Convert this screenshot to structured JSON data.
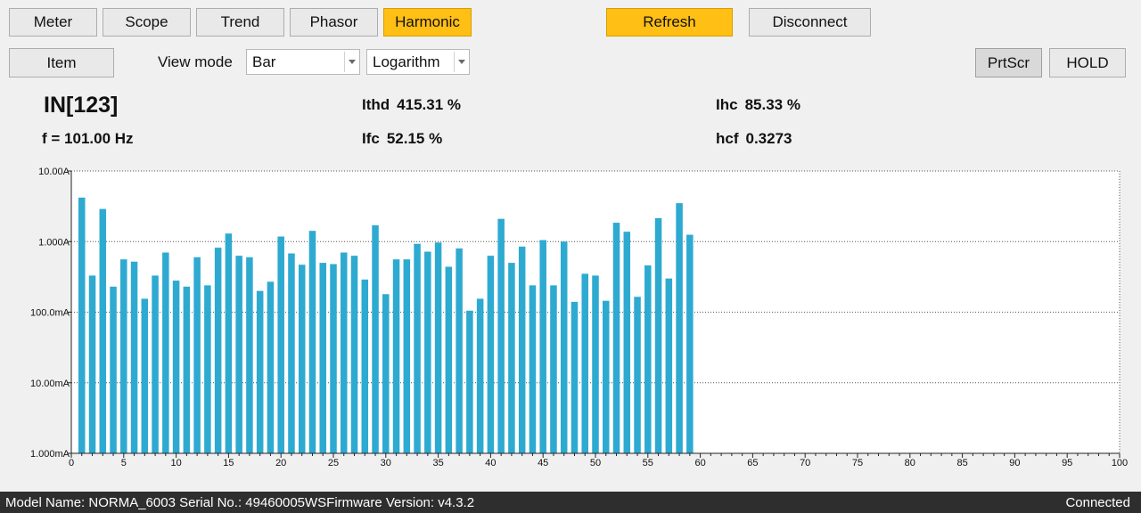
{
  "tabs": [
    {
      "label": "Meter"
    },
    {
      "label": "Scope"
    },
    {
      "label": "Trend"
    },
    {
      "label": "Phasor"
    },
    {
      "label": "Harmonic"
    }
  ],
  "active_tab": "Harmonic",
  "accent_color": "#ffbf14",
  "bar_color": "#2eaad1",
  "actions": {
    "refresh": "Refresh",
    "disconnect": "Disconnect"
  },
  "toolbar": {
    "item": "Item",
    "view_mode_label": "View mode",
    "view_mode_value": "Bar",
    "scale_value": "Logarithm",
    "prtscr": "PrtScr",
    "hold": "HOLD"
  },
  "measurements": {
    "channel": "IN[123]",
    "frequency": "f = 101.00 Hz",
    "ithd_label": "Ithd",
    "ithd_value": "415.31 %",
    "ifc_label": "Ifc",
    "ifc_value": "52.15 %",
    "ihc_label": "Ihc",
    "ihc_value": "85.33 %",
    "hcf_label": "hcf",
    "hcf_value": "0.3273"
  },
  "chart_data": {
    "type": "bar",
    "y_scale": "log",
    "ylim": [
      0.001,
      10
    ],
    "xlim": [
      0,
      100
    ],
    "y_tick_labels": [
      "10.00A",
      "1.000A",
      "100.0mA",
      "10.00mA",
      "1.000mA"
    ],
    "y_tick_values": [
      10,
      1,
      0.1,
      0.01,
      0.001
    ],
    "x_tick_labels": [
      "0",
      "5",
      "10",
      "15",
      "20",
      "25",
      "30",
      "35",
      "40",
      "45",
      "50",
      "55",
      "60",
      "65",
      "70",
      "75",
      "80",
      "85",
      "90",
      "95",
      "100"
    ],
    "x_tick_values": [
      0,
      5,
      10,
      15,
      20,
      25,
      30,
      35,
      40,
      45,
      50,
      55,
      60,
      65,
      70,
      75,
      80,
      85,
      90,
      95,
      100
    ],
    "grid": true,
    "harmonic_order": [
      1,
      2,
      3,
      4,
      5,
      6,
      7,
      8,
      9,
      10,
      11,
      12,
      13,
      14,
      15,
      16,
      17,
      18,
      19,
      20,
      21,
      22,
      23,
      24,
      25,
      26,
      27,
      28,
      29,
      30,
      31,
      32,
      33,
      34,
      35,
      36,
      37,
      38,
      39,
      40,
      41,
      42,
      43,
      44,
      45,
      46,
      47,
      48,
      49,
      50,
      51,
      52,
      53,
      54,
      55,
      56,
      57,
      58,
      59
    ],
    "values_A": [
      4.2,
      0.33,
      2.9,
      0.23,
      0.56,
      0.52,
      0.155,
      0.33,
      0.7,
      0.28,
      0.23,
      0.6,
      0.24,
      0.82,
      1.3,
      0.63,
      0.6,
      0.2,
      0.27,
      1.18,
      0.68,
      0.47,
      1.42,
      0.5,
      0.48,
      0.7,
      0.63,
      0.29,
      1.7,
      0.18,
      0.56,
      0.56,
      0.93,
      0.72,
      0.97,
      0.44,
      0.8,
      0.105,
      0.155,
      0.63,
      2.1,
      0.5,
      0.85,
      0.24,
      1.05,
      0.24,
      1.0,
      0.14,
      0.35,
      0.33,
      0.145,
      1.85,
      1.38,
      0.165,
      0.46,
      2.15,
      0.3,
      3.5,
      1.25
    ]
  },
  "status": {
    "info": "Model Name:  NORMA_6003 Serial No.:  49460005WSFirmware Version:  v4.3.2",
    "connection": "Connected"
  }
}
